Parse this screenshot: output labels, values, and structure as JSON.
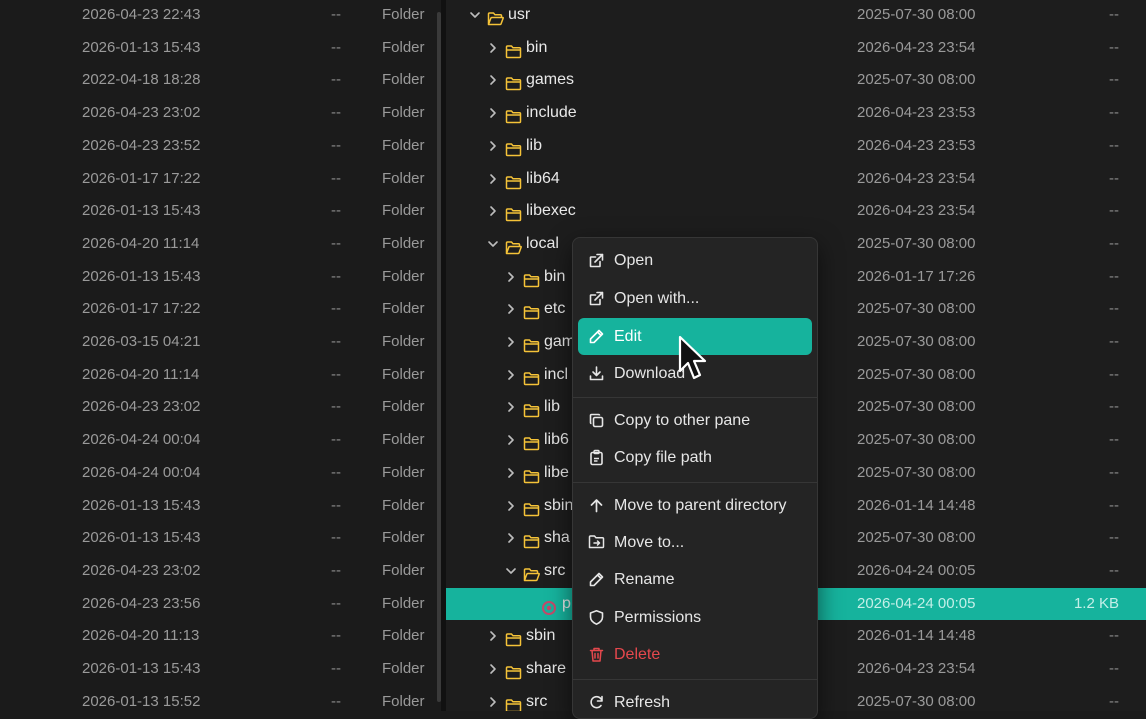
{
  "left_pane": {
    "rows": [
      {
        "date": "2026-04-23 22:43",
        "size": "--",
        "type": "Folder"
      },
      {
        "date": "2026-01-13 15:43",
        "size": "--",
        "type": "Folder"
      },
      {
        "date": "2022-04-18 18:28",
        "size": "--",
        "type": "Folder"
      },
      {
        "date": "2026-04-23 23:02",
        "size": "--",
        "type": "Folder"
      },
      {
        "date": "2026-04-23 23:52",
        "size": "--",
        "type": "Folder"
      },
      {
        "date": "2026-01-17 17:22",
        "size": "--",
        "type": "Folder"
      },
      {
        "date": "2026-01-13 15:43",
        "size": "--",
        "type": "Folder"
      },
      {
        "date": "2026-04-20 11:14",
        "size": "--",
        "type": "Folder"
      },
      {
        "date": "2026-01-13 15:43",
        "size": "--",
        "type": "Folder"
      },
      {
        "date": "2026-01-17 17:22",
        "size": "--",
        "type": "Folder"
      },
      {
        "date": "2026-03-15 04:21",
        "size": "--",
        "type": "Folder"
      },
      {
        "date": "2026-04-20 11:14",
        "size": "--",
        "type": "Folder"
      },
      {
        "date": "2026-04-23 23:02",
        "size": "--",
        "type": "Folder"
      },
      {
        "date": "2026-04-24 00:04",
        "size": "--",
        "type": "Folder"
      },
      {
        "date": "2026-04-24 00:04",
        "size": "--",
        "type": "Folder"
      },
      {
        "date": "2026-01-13 15:43",
        "size": "--",
        "type": "Folder"
      },
      {
        "date": "2026-01-13 15:43",
        "size": "--",
        "type": "Folder"
      },
      {
        "date": "2026-04-23 23:02",
        "size": "--",
        "type": "Folder"
      },
      {
        "date": "2026-04-23 23:56",
        "size": "--",
        "type": "Folder"
      },
      {
        "date": "2026-04-20 11:13",
        "size": "--",
        "type": "Folder"
      },
      {
        "date": "2026-01-13 15:43",
        "size": "--",
        "type": "Folder"
      },
      {
        "date": "2026-01-13 15:52",
        "size": "--",
        "type": "Folder"
      }
    ]
  },
  "right_pane": {
    "rows": [
      {
        "name": "usr",
        "depth": 0,
        "expanded": true,
        "kind": "folder",
        "date": "2025-07-30 08:00",
        "size": "--"
      },
      {
        "name": "bin",
        "depth": 1,
        "expanded": false,
        "kind": "folder",
        "date": "2026-04-23 23:54",
        "size": "--"
      },
      {
        "name": "games",
        "depth": 1,
        "expanded": false,
        "kind": "folder",
        "date": "2025-07-30 08:00",
        "size": "--"
      },
      {
        "name": "include",
        "depth": 1,
        "expanded": false,
        "kind": "folder",
        "date": "2026-04-23 23:53",
        "size": "--"
      },
      {
        "name": "lib",
        "depth": 1,
        "expanded": false,
        "kind": "folder",
        "date": "2026-04-23 23:53",
        "size": "--"
      },
      {
        "name": "lib64",
        "depth": 1,
        "expanded": false,
        "kind": "folder",
        "date": "2026-04-23 23:54",
        "size": "--"
      },
      {
        "name": "libexec",
        "depth": 1,
        "expanded": false,
        "kind": "folder",
        "date": "2026-04-23 23:54",
        "size": "--"
      },
      {
        "name": "local",
        "depth": 1,
        "expanded": true,
        "kind": "folder",
        "date": "2025-07-30 08:00",
        "size": "--"
      },
      {
        "name": "bin",
        "depth": 2,
        "expanded": false,
        "kind": "folder",
        "date": "2026-01-17 17:26",
        "size": "--"
      },
      {
        "name": "etc",
        "depth": 2,
        "expanded": false,
        "kind": "folder",
        "date": "2025-07-30 08:00",
        "size": "--"
      },
      {
        "name": "gam",
        "depth": 2,
        "expanded": false,
        "kind": "folder",
        "date": "2025-07-30 08:00",
        "size": "--"
      },
      {
        "name": "incl",
        "depth": 2,
        "expanded": false,
        "kind": "folder",
        "date": "2025-07-30 08:00",
        "size": "--"
      },
      {
        "name": "lib",
        "depth": 2,
        "expanded": false,
        "kind": "folder",
        "date": "2025-07-30 08:00",
        "size": "--"
      },
      {
        "name": "lib6",
        "depth": 2,
        "expanded": false,
        "kind": "folder",
        "date": "2025-07-30 08:00",
        "size": "--"
      },
      {
        "name": "libe",
        "depth": 2,
        "expanded": false,
        "kind": "folder",
        "date": "2025-07-30 08:00",
        "size": "--"
      },
      {
        "name": "sbin",
        "depth": 2,
        "expanded": false,
        "kind": "folder",
        "date": "2026-01-14 14:48",
        "size": "--"
      },
      {
        "name": "sha",
        "depth": 2,
        "expanded": false,
        "kind": "folder",
        "date": "2025-07-30 08:00",
        "size": "--"
      },
      {
        "name": "src",
        "depth": 2,
        "expanded": true,
        "kind": "folder",
        "date": "2026-04-24 00:05",
        "size": "--"
      },
      {
        "name": "p",
        "depth": 3,
        "expanded": false,
        "kind": "file",
        "selected": true,
        "date": "2026-04-24 00:05",
        "size": "1.2 KB"
      },
      {
        "name": "sbin",
        "depth": 1,
        "expanded": false,
        "kind": "folder",
        "date": "2026-01-14 14:48",
        "size": "--"
      },
      {
        "name": "share",
        "depth": 1,
        "expanded": false,
        "kind": "folder",
        "date": "2026-04-23 23:54",
        "size": "--"
      },
      {
        "name": "src",
        "depth": 1,
        "expanded": false,
        "kind": "folder",
        "date": "2025-07-30 08:00",
        "size": "--"
      }
    ]
  },
  "context_menu": {
    "items": [
      {
        "label": "Open",
        "icon": "external-link-icon"
      },
      {
        "label": "Open with...",
        "icon": "external-link-icon"
      },
      {
        "label": "Edit",
        "icon": "pencil-icon",
        "active": true
      },
      {
        "label": "Download",
        "icon": "download-icon"
      },
      {
        "label": "Copy to other pane",
        "icon": "copy-icon"
      },
      {
        "label": "Copy file path",
        "icon": "clipboard-icon"
      },
      {
        "label": "Move to parent directory",
        "icon": "arrow-up-icon"
      },
      {
        "label": "Move to...",
        "icon": "folder-move-icon"
      },
      {
        "label": "Rename",
        "icon": "pencil-icon"
      },
      {
        "label": "Permissions",
        "icon": "shield-icon"
      },
      {
        "label": "Delete",
        "icon": "trash-icon",
        "danger": true
      },
      {
        "label": "Refresh",
        "icon": "refresh-icon"
      }
    ]
  },
  "colors": {
    "accent": "#16b39d",
    "folder": "#f5c338",
    "danger": "#e5484d",
    "file_icon": "#c44a6a"
  }
}
